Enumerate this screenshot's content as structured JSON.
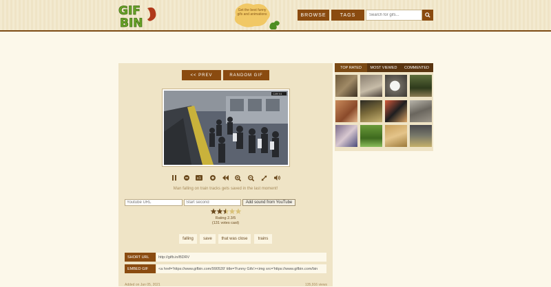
{
  "header": {
    "logo_text": "GIF BIN",
    "tagline": "Get the best funny gifs and animations",
    "browse_label": "BROWSE",
    "tags_label": "TAGS",
    "search_placeholder": "Search for gifs..."
  },
  "nav": {
    "prev_label": "<< PREV",
    "random_label": "RANDOM GIF"
  },
  "player": {
    "controls": [
      "pause-icon",
      "minus-icon",
      "one-x-icon",
      "plus-icon",
      "rewind-icon",
      "zoom-in-icon",
      "zoom-out-icon",
      "expand-icon",
      "volume-icon"
    ],
    "one_x_label": "x1",
    "video_stamp": "CAM 04"
  },
  "gif": {
    "caption": "Man falling on train tracks gets saved in the last moment!",
    "rating_value": 2.5,
    "rating_text": "Rating 2.3/5",
    "votes_text": "(131 votes cast)"
  },
  "youtube": {
    "url_placeholder": "Youtube URL",
    "start_placeholder": "Start second",
    "add_label": "Add sound from YouTube"
  },
  "tags": [
    "falling",
    "save",
    "that was close",
    "trains"
  ],
  "links": {
    "short_label": "SHORT URL",
    "short_value": "http://gifb.in/BDRV",
    "embed_label": "EMBED GIF",
    "embed_value": "<a href='https://www.gifbin.com/990539' title='Funny Gifs'><img src='https://www.gifbin.com/bin"
  },
  "footer": {
    "added": "Added on Jan 05, 2021",
    "views": "135,916 views"
  },
  "sidebar": {
    "tabs": [
      "TOP RATED",
      "MOST VIEWED",
      "COMMENTED"
    ],
    "active_tab": "TOP RATED"
  },
  "colors": {
    "brand_brown": "#8a4b10",
    "page_bg": "#fcf8ea",
    "panel_bg": "#efe4c6"
  }
}
